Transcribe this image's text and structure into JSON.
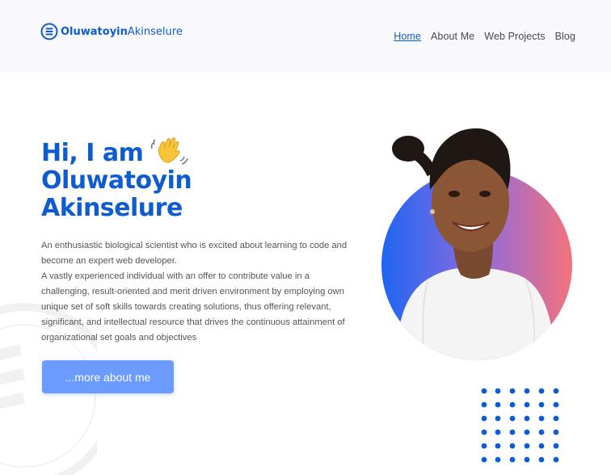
{
  "header": {
    "logo": {
      "first": "Oluwatoyin",
      "last": "Akinselure",
      "icon": "logo-circle-lines-icon"
    },
    "nav": [
      {
        "label": "Home",
        "active": true
      },
      {
        "label": "About Me",
        "active": false
      },
      {
        "label": "Web Projects",
        "active": false
      },
      {
        "label": "Blog",
        "active": false
      }
    ]
  },
  "hero": {
    "greeting": "Hi, I am",
    "greeting_icon": "waving-hand-icon",
    "first_name": "Oluwatoyin",
    "last_name": "Akinselure",
    "bio_1": "An enthusiastic biological scientist who is excited about learning to code and become an expert web developer.",
    "bio_2": "A vastly experienced individual with an offer to contribute value in a challenging, result-oriented and merit driven environment by employing own unique set of soft skills towards creating solutions, thus offering relevant, significant, and intellectual resource that drives the continuous attainment of organizational set goals and objectives",
    "cta_label": "...more about me"
  },
  "colors": {
    "brand_blue": "#0e5ccf",
    "header_bg": "#f8f8fd",
    "cta_bg": "#6b9bff",
    "gradient_start": "#1f66f2",
    "gradient_end": "#f4727c",
    "dot_color": "#0e5ccf"
  },
  "portrait": {
    "icon": "profile-photo"
  }
}
